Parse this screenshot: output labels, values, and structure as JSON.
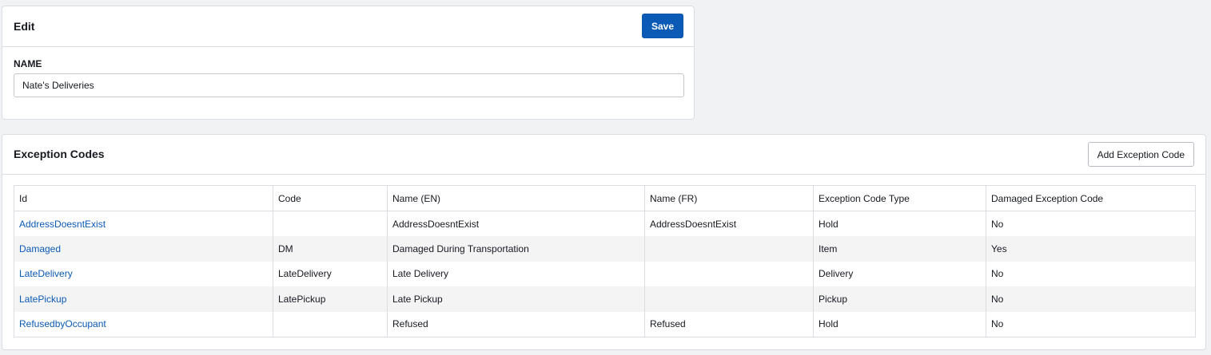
{
  "edit": {
    "title": "Edit",
    "save_label": "Save",
    "name_label": "NAME",
    "name_value": "Nate's Deliveries"
  },
  "exceptions": {
    "title": "Exception Codes",
    "add_label": "Add Exception Code",
    "columns": [
      "Id",
      "Code",
      "Name (EN)",
      "Name (FR)",
      "Exception Code Type",
      "Damaged Exception Code"
    ],
    "rows": [
      [
        "AddressDoesntExist",
        "",
        "AddressDoesntExist",
        "AddressDoesntExist",
        "Hold",
        "No"
      ],
      [
        "Damaged",
        "DM",
        "Damaged During Transportation",
        "",
        "Item",
        "Yes"
      ],
      [
        "LateDelivery",
        "LateDelivery",
        "Late Delivery",
        "",
        "Delivery",
        "No"
      ],
      [
        "LatePickup",
        "LatePickup",
        "Late Pickup",
        "",
        "Pickup",
        "No"
      ],
      [
        "RefusedbyOccupant",
        "",
        "Refused",
        "Refused",
        "Hold",
        "No"
      ]
    ]
  },
  "colors": {
    "primary": "#0b5ab5",
    "link": "#0b5ab5",
    "background": "#f1f2f4",
    "stripe": "#f4f4f5"
  }
}
